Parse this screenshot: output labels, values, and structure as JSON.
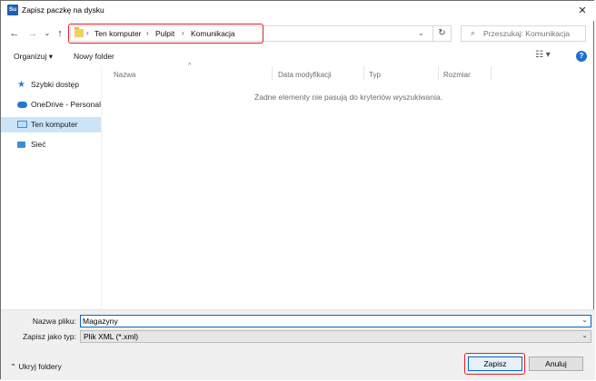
{
  "window": {
    "app_icon_text": "Su",
    "title": "Zapisz paczkę na dysku",
    "close_glyph": "✕"
  },
  "navigation": {
    "back_glyph": "←",
    "forward_glyph": "→",
    "recent_glyph": "⌄",
    "up_glyph": "↑"
  },
  "address_bar": {
    "breadcrumbs": [
      "Ten komputer",
      "Pulpit",
      "Komunikacja"
    ],
    "separator": "›",
    "dropdown_glyph": "⌄",
    "refresh_glyph": "↻"
  },
  "search": {
    "placeholder": "Przeszukaj: Komunikacja",
    "icon": "search-icon",
    "icon_glyph": "⌕"
  },
  "toolbar": {
    "organize_label": "Organizuj ▾",
    "new_folder_label": "Nowy folder",
    "view_glyph": "☷ ▾",
    "help_glyph": "?"
  },
  "sidebar": {
    "items": [
      {
        "label": "Szybki dostęp",
        "icon": "star-icon",
        "selected": false
      },
      {
        "label": "OneDrive - Personal",
        "icon": "cloud-icon",
        "selected": false
      },
      {
        "label": "Ten komputer",
        "icon": "computer-icon",
        "selected": true
      },
      {
        "label": "Sieć",
        "icon": "network-icon",
        "selected": false
      }
    ]
  },
  "file_list": {
    "columns": [
      "Nazwa",
      "Data modyfikacji",
      "Typ",
      "Rozmiar"
    ],
    "sort_glyph": "^",
    "empty_message": "Żadne elementy nie pasują do kryteriów wyszukiwania."
  },
  "form": {
    "filename_label": "Nazwa pliku:",
    "filename_value": "Magazyny",
    "filetype_label": "Zapisz jako typ:",
    "filetype_value": "Plik XML (*.xml)",
    "dropdown_glyph": "⌄"
  },
  "footer": {
    "hide_folders_label": "⌃  Ukryj foldery",
    "save_label": "Zapisz",
    "cancel_label": "Anuluj"
  },
  "colors": {
    "accent": "#0a64c8",
    "highlight": "#e0212b",
    "selection": "#cce4f7"
  }
}
